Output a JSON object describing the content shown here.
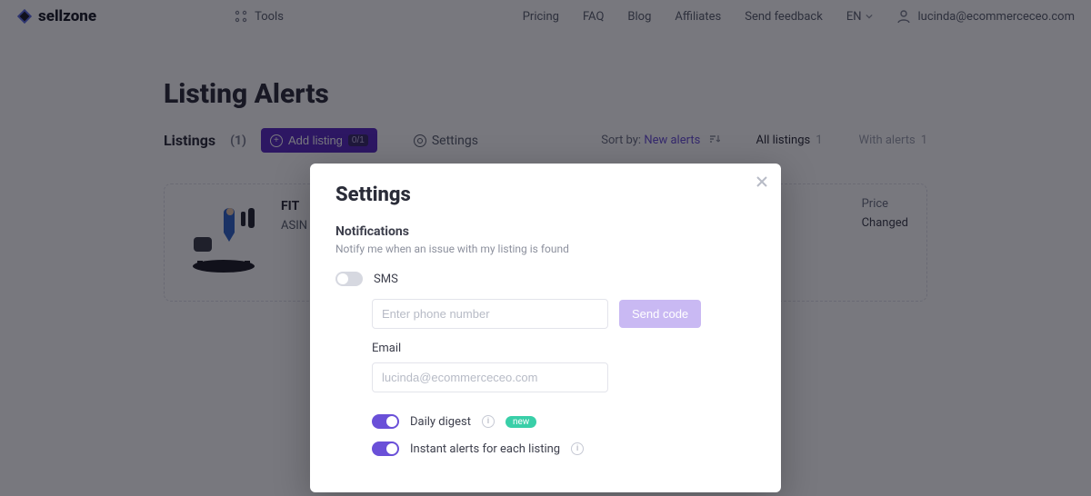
{
  "brand": "sellzone",
  "nav": {
    "tools": "Tools",
    "links": [
      "Pricing",
      "FAQ",
      "Blog",
      "Affiliates",
      "Send feedback"
    ],
    "lang": "EN",
    "user_email": "lucinda@ecommerceceo.com"
  },
  "page": {
    "title": "Listing Alerts",
    "listings_label": "Listings",
    "listings_count": "(1)",
    "add_listing": "Add listing",
    "add_listing_badge": "0/1",
    "settings": "Settings",
    "sort_label": "Sort by:",
    "sort_value": "New alerts",
    "filter_all": "All listings",
    "filter_all_n": "1",
    "filter_with": "With alerts",
    "filter_with_n": "1"
  },
  "card": {
    "title_fragment": "FIT",
    "asin_fragment": "ASIN",
    "price_label": "Price",
    "price_status": "Changed"
  },
  "modal": {
    "title": "Settings",
    "section": "Notifications",
    "section_sub": "Notify me when an issue with my listing is found",
    "sms_label": "SMS",
    "phone_placeholder": "Enter phone number",
    "send_code": "Send code",
    "email_label": "Email",
    "email_value": "lucinda@ecommerceceo.com",
    "daily_digest": "Daily digest",
    "new_pill": "new",
    "instant_alerts": "Instant alerts for each listing"
  }
}
